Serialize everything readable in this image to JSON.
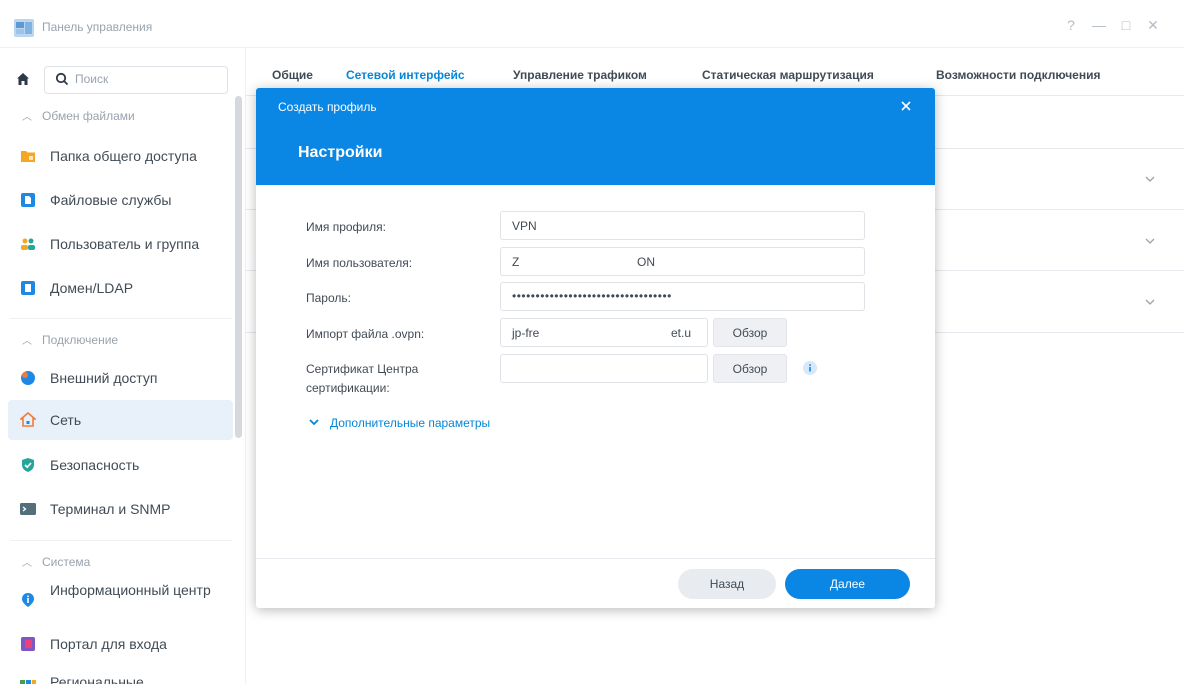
{
  "window": {
    "title": "Панель управления",
    "controls": [
      "?",
      "—",
      "□",
      "✕"
    ]
  },
  "sidebar": {
    "search_placeholder": "Поиск",
    "sections": [
      {
        "title": "Обмен файлами"
      },
      {
        "title": "Подключение"
      },
      {
        "title": "Система"
      }
    ],
    "items": [
      {
        "label": "Папка общего доступа",
        "icon": "shared-folder-icon",
        "color": "#f5a623"
      },
      {
        "label": "Файловые службы",
        "icon": "file-services-icon",
        "color": "#1e88e5"
      },
      {
        "label": "Пользователь и группа",
        "icon": "user-group-icon",
        "color": "#26a69a"
      },
      {
        "label": "Домен/LDAP",
        "icon": "domain-ldap-icon",
        "color": "#1e88e5"
      },
      {
        "label": "Внешний доступ",
        "icon": "external-access-icon",
        "color": "#1e88e5"
      },
      {
        "label": "Сеть",
        "icon": "network-house-icon",
        "color": "#f07c3c"
      },
      {
        "label": "Безопасность",
        "icon": "shield-icon",
        "color": "#26a69a"
      },
      {
        "label": "Терминал и SNMP",
        "icon": "terminal-icon",
        "color": "#546e7a"
      },
      {
        "label": "Информационный центр",
        "icon": "info-center-icon",
        "color": "#1e88e5"
      },
      {
        "label": "Портал для входа",
        "icon": "login-portal-icon",
        "color": "#7e57c2"
      },
      {
        "label": "Региональные",
        "icon": "regional-icon",
        "color": "#43a047"
      }
    ]
  },
  "main": {
    "tabs": [
      {
        "label": "Общие"
      },
      {
        "label": "Сетевой интерфейс"
      },
      {
        "label": "Управление трафиком"
      },
      {
        "label": "Статическая маршрутизация"
      },
      {
        "label": "Возможности подключения"
      }
    ],
    "active_tab": "Сетевой интерфейс"
  },
  "dialog": {
    "title": "Создать профиль",
    "heading": "Настройки",
    "fields": {
      "profile_name": {
        "label": "Имя профиля:",
        "value": "VPN"
      },
      "username": {
        "label": "Имя пользователя:",
        "value": "Z",
        "value_tail": "ON"
      },
      "password": {
        "label": "Пароль:",
        "value": "••••••••••••••••••••••••••••••••••"
      },
      "ovpn_import": {
        "label": "Импорт файла .ovpn:",
        "value": "jp-fre",
        "value_tail": "et.u"
      },
      "ca_cert": {
        "label": "Сертификат Центра сертификации:",
        "value": ""
      }
    },
    "browse_label": "Обзор",
    "advanced_link": "Дополнительные параметры",
    "back_label": "Назад",
    "next_label": "Далее"
  },
  "colors": {
    "accent": "#0a86e4",
    "link": "#0786d7",
    "active_nav_bg": "#e8f0fa"
  }
}
